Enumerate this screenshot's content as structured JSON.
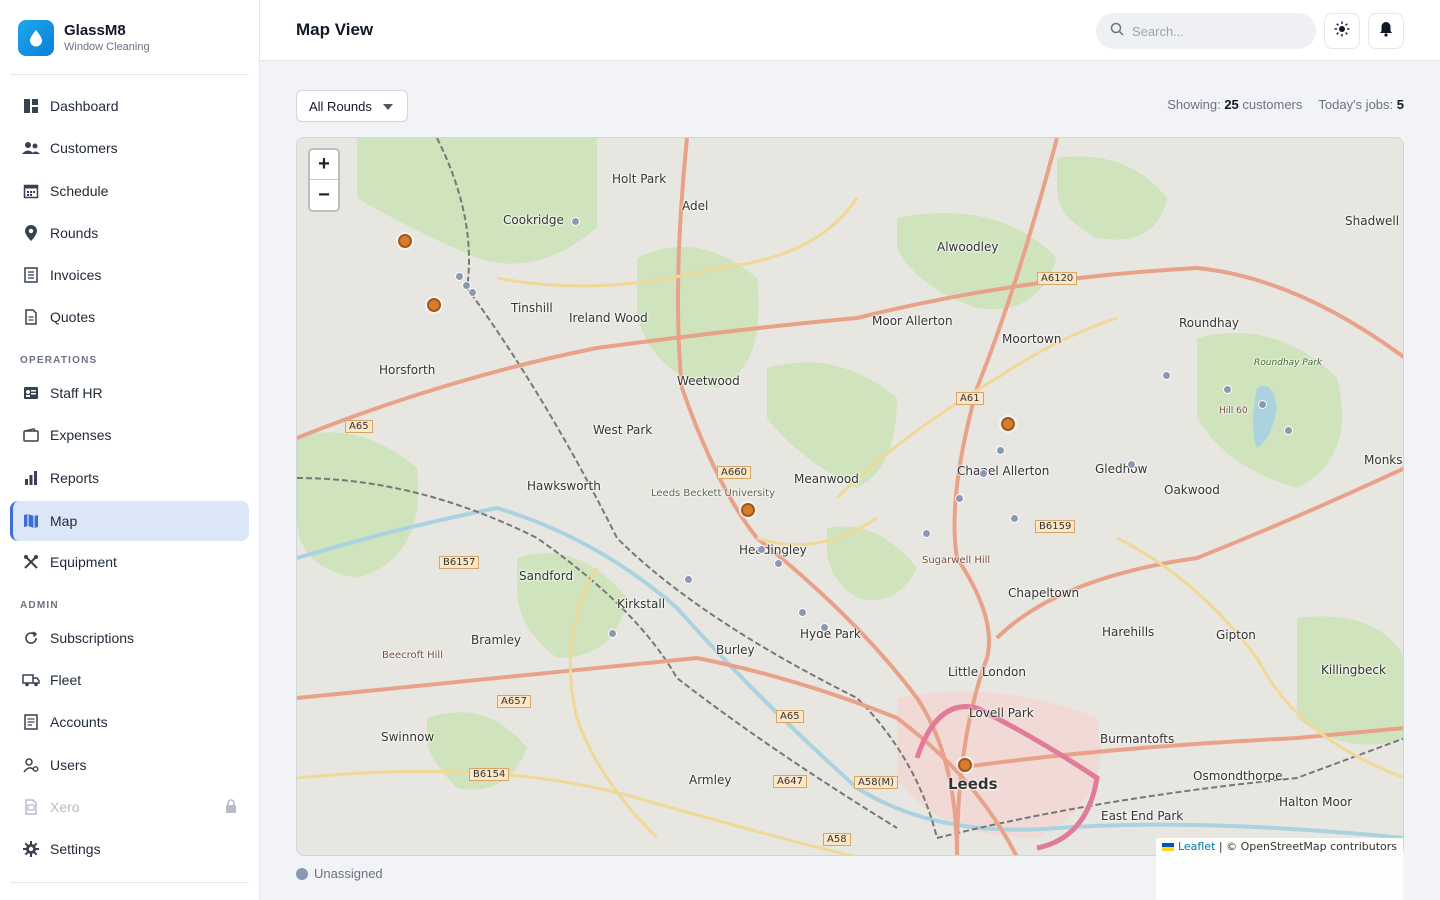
{
  "brand": {
    "name": "GlassM8",
    "subtitle": "Window Cleaning"
  },
  "nav": {
    "main": [
      {
        "label": "Dashboard",
        "icon": "dashboard-icon"
      },
      {
        "label": "Customers",
        "icon": "users-icon"
      },
      {
        "label": "Schedule",
        "icon": "calendar-icon"
      },
      {
        "label": "Rounds",
        "icon": "location-pin-icon"
      },
      {
        "label": "Invoices",
        "icon": "invoice-icon"
      },
      {
        "label": "Quotes",
        "icon": "quote-document-icon"
      }
    ],
    "operations_label": "OPERATIONS",
    "operations": [
      {
        "label": "Staff HR",
        "icon": "id-card-icon"
      },
      {
        "label": "Expenses",
        "icon": "wallet-icon"
      },
      {
        "label": "Reports",
        "icon": "bar-chart-icon"
      },
      {
        "label": "Map",
        "icon": "map-icon",
        "active": true
      },
      {
        "label": "Equipment",
        "icon": "tools-icon"
      }
    ],
    "admin_label": "ADMIN",
    "admin": [
      {
        "label": "Subscriptions",
        "icon": "refresh-icon"
      },
      {
        "label": "Fleet",
        "icon": "truck-icon"
      },
      {
        "label": "Accounts",
        "icon": "ledger-icon"
      },
      {
        "label": "Users",
        "icon": "user-cog-icon"
      },
      {
        "label": "Xero",
        "icon": "xero-icon",
        "disabled": true,
        "locked": true
      },
      {
        "label": "Settings",
        "icon": "gear-icon"
      }
    ]
  },
  "header": {
    "title": "Map View",
    "search_placeholder": "Search..."
  },
  "toolbar": {
    "round_filter": "All Rounds",
    "showing_label": "Showing:",
    "showing_count": "25",
    "showing_unit": "customers",
    "jobs_label": "Today's jobs:",
    "jobs_count": "5"
  },
  "map": {
    "zoom_in": "+",
    "zoom_out": "−",
    "attribution_link": "Leaflet",
    "attribution_text": "| © OpenStreetMap contributors",
    "places": [
      "Holt Park",
      "Adel",
      "Cookridge",
      "Alwoodley",
      "Shadwell",
      "Tinshill",
      "Ireland Wood",
      "Moor Allerton",
      "Roundhay",
      "Moortown",
      "Horsforth",
      "Weetwood",
      "West Park",
      "Gledhow",
      "Oakwood",
      "Hawksworth",
      "Meanwood",
      "Chapel Allerton",
      "Leeds Beckett University",
      "Headingley",
      "Sandford",
      "Kirkstall",
      "Chapeltown",
      "Bramley",
      "Hyde Park",
      "Harehills",
      "Gipton",
      "Burley",
      "Little London",
      "Killingbeck",
      "Lovell Park",
      "Swinnow",
      "Burmantofts",
      "Osmondthorpe",
      "Armley",
      "Leeds",
      "Halton Moor",
      "East End Park",
      "Sugarwell Hill",
      "Beecroft Hill",
      "Roundhay Park",
      "Hill 60",
      "Monks"
    ],
    "roads": [
      "A6120",
      "A65",
      "A660",
      "A61",
      "B6159",
      "B6157",
      "A657",
      "A65",
      "B6154",
      "A647",
      "A58(M)",
      "A58"
    ]
  },
  "legend": {
    "unassigned": "Unassigned"
  },
  "colors": {
    "accent": "#3b6ed6",
    "job_marker": "#d97b2a",
    "customer_marker": "#8a98b4"
  }
}
